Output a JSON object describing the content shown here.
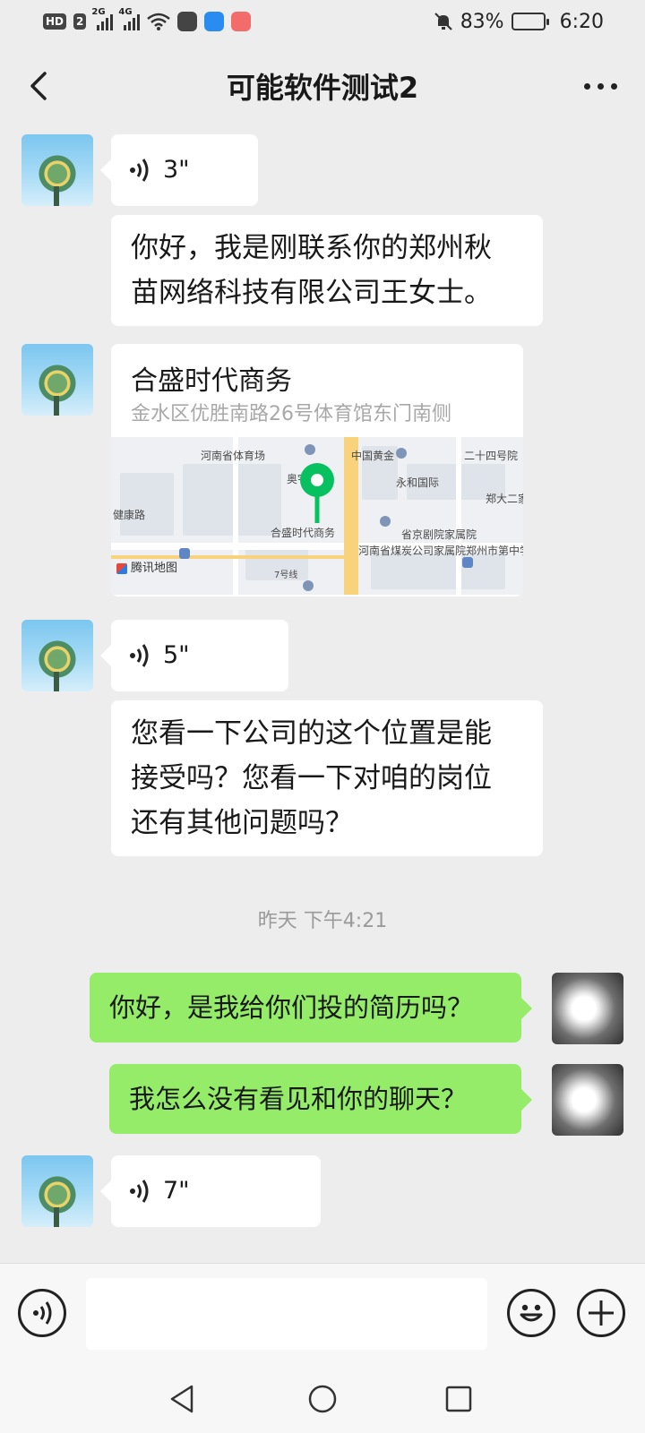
{
  "status_bar": {
    "hd_badge": "HD",
    "hd_sim": "2",
    "net1": "2G",
    "net2": "4G",
    "battery_percent": "83%",
    "battery_level": 0.83,
    "time": "6:20"
  },
  "header": {
    "title": "可能软件测试2",
    "back_icon": "back-chevron-icon",
    "more_icon": "more-dots-icon"
  },
  "messages": [
    {
      "sender": "them",
      "type": "voice",
      "duration": "3\""
    },
    {
      "sender": "them",
      "type": "text",
      "lines": [
        "你好，我是刚联系你的郑州秋",
        "苗网络科技有限公司王女士。"
      ]
    },
    {
      "sender": "them",
      "type": "location",
      "name": "合盛时代商务",
      "address": "金水区优胜南路26号体育馆东门南侧",
      "map_labels": [
        "河南省体育场",
        "中国黄金",
        "二十四号院",
        "奥宇科技",
        "永和国际",
        "郑大二家属",
        "健康路",
        "合盛时代商务",
        "省京剧院家属院",
        "河南省煤炭公司家属院",
        "郑州市第中学(东",
        "7号线"
      ],
      "map_brand": "腾讯地图"
    },
    {
      "sender": "them",
      "type": "voice",
      "duration": "5\""
    },
    {
      "sender": "them",
      "type": "text",
      "lines": [
        "您看一下公司的这个位置是能",
        "接受吗？您看一下对咱的岗位",
        "还有其他问题吗？"
      ]
    },
    {
      "sender": "me",
      "type": "text",
      "lines": [
        "你好，是我给你们投的简历吗？"
      ]
    },
    {
      "sender": "me",
      "type": "text",
      "lines": [
        "我怎么没有看见和你的聊天？"
      ]
    },
    {
      "sender": "them",
      "type": "voice",
      "duration": "7\""
    }
  ],
  "timestamp": "昨天 下午4:21",
  "input": {
    "placeholder": "",
    "value": ""
  },
  "colors": {
    "background": "#ededed",
    "my_bubble": "#95ec69",
    "their_bubble": "#ffffff",
    "pin": "#07c160"
  }
}
